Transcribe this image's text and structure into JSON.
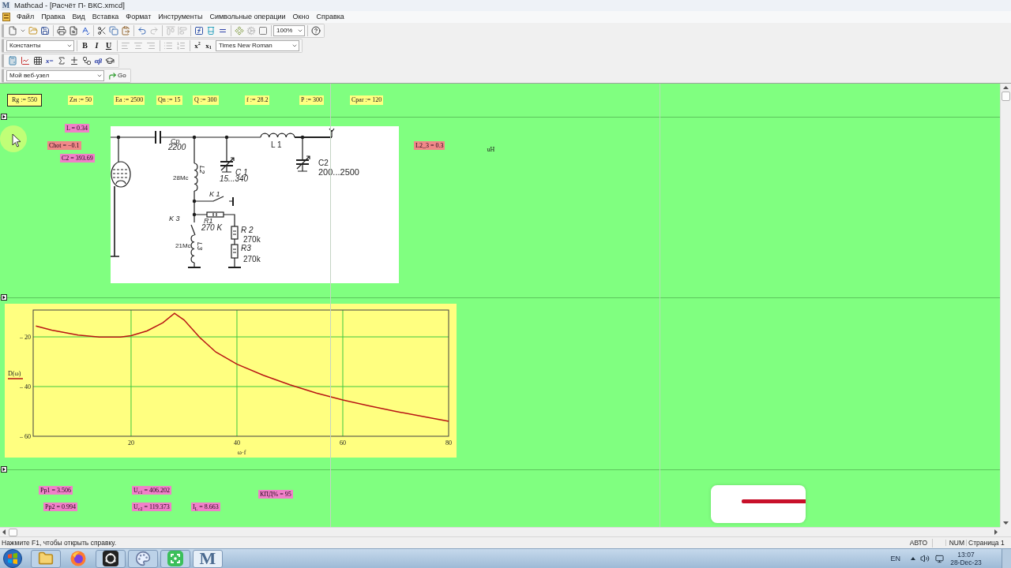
{
  "window": {
    "icon_letter": "M",
    "title": "Mathcad - [Расчёт П- ВКС.xmcd]"
  },
  "menu": [
    "Файл",
    "Правка",
    "Вид",
    "Вставка",
    "Формат",
    "Инструменты",
    "Символьные операции",
    "Окно",
    "Справка"
  ],
  "standard_toolbar": {
    "buttons": [
      {
        "disabled": false
      },
      {
        "disabled": false
      },
      {
        "disabled": false
      },
      {
        "disabled": false
      },
      {
        "disabled": false
      },
      {
        "disabled": false
      },
      {
        "disabled": false
      },
      {
        "disabled": false
      },
      {
        "disabled": false
      },
      {
        "disabled": false
      },
      {
        "disabled": false
      },
      {
        "disabled": true
      },
      {
        "disabled": true
      },
      {
        "disabled": true
      },
      {
        "disabled": false
      },
      {
        "disabled": false
      },
      {
        "disabled": false
      },
      {
        "disabled": false
      },
      {
        "disabled": true
      },
      {
        "disabled": false
      },
      {
        "disabled": false
      }
    ],
    "zoom": "100%"
  },
  "format_toolbar": {
    "style": "Константы",
    "text_buttons": [
      {
        "label": "B"
      },
      {
        "label": "I"
      },
      {
        "label": "U"
      }
    ],
    "align_buttons": [
      {
        "disabled": true
      },
      {
        "disabled": true
      },
      {
        "disabled": true
      }
    ],
    "list_buttons": [
      {
        "disabled": true
      },
      {
        "disabled": true
      }
    ],
    "script_buttons": [
      {
        "label": "x$^{2}$"
      },
      {
        "label": "x$_{1}$"
      }
    ],
    "font": "Times New Roman"
  },
  "math_toolbar": {
    "evaluation_label": "x=",
    "greek_label": "αβ"
  },
  "web_toolbar": {
    "address": "Мой веб-узел",
    "go": "Go"
  },
  "worksheet": {
    "definitions": [
      {
        "text": "Rg := 550",
        "selected": true
      },
      {
        "text": "Zн := 50",
        "selected": false
      },
      {
        "text": "Ea := 2500",
        "selected": false
      },
      {
        "text": "Qn := 15",
        "selected": false
      },
      {
        "text": "Q := 300",
        "selected": false
      },
      {
        "text": "f := 28.2",
        "selected": false
      },
      {
        "text": "P := 300",
        "selected": false
      },
      {
        "text": "Cpar := 120",
        "selected": false
      }
    ],
    "results_top": [
      {
        "text": "L = 0.34",
        "color": "#f080c8"
      },
      {
        "text": "Chot = −0.1",
        "color": "#f08888"
      },
      {
        "text": "C2 = 393.69",
        "color": "#f080c8"
      }
    ],
    "schematic": {
      "labels": [
        "Cp",
        "2200",
        "L 1",
        "C 1",
        "15...340",
        "C2",
        "200...2500",
        "28Mc",
        "L2",
        "K 1",
        "K 3",
        "R1",
        "270 K",
        "R 2",
        "270k",
        "R3",
        "270k",
        "21Mc",
        "L3"
      ]
    },
    "side_result": {
      "text": "L2_3 = 0.3",
      "color": "#f08888"
    },
    "unit_note": "uH",
    "plot": {
      "chart_data": {
        "type": "line",
        "xlabel": "ω·f",
        "ylabel": "D(ω)",
        "x": [
          2,
          5,
          10,
          14,
          18,
          20,
          23,
          26,
          28.2,
          30,
          33,
          36,
          40,
          45,
          50,
          55,
          60,
          65,
          70,
          75,
          80
        ],
        "series": [
          {
            "color": "#b81414",
            "values": [
              -15.6,
              -17.3,
              -19.3,
              -20.1,
              -20.1,
              -19.5,
              -17.6,
              -14.3,
              -10.5,
              -13.2,
              -20.3,
              -26.1,
              -31,
              -35.5,
              -39.3,
              -42.6,
              -45.4,
              -47.8,
              -50,
              -52,
              -54
            ]
          }
        ],
        "xlim": [
          1.5,
          80
        ],
        "ylim": [
          -60,
          -9.2
        ],
        "xticks": [
          20,
          40,
          60,
          80
        ],
        "yticks": [
          {
            "value": -20,
            "label": "– 20"
          },
          {
            "value": -40,
            "label": "– 40"
          },
          {
            "value": -60,
            "label": "– 60"
          }
        ],
        "grid": true
      }
    },
    "results_bottom": [
      {
        "text": "Pp1 = 3.506",
        "color": "#f080c8"
      },
      {
        "text": "Pp2 = 0.994",
        "color": "#f080c8"
      },
      {
        "text": "U$_{c1}$ = 406.202",
        "color": "#f080c8"
      },
      {
        "text": "U$_{c2}$ = 119.373",
        "color": "#f080c8"
      },
      {
        "text": "I$_{L}$ = 8.663",
        "color": "#f080c8"
      },
      {
        "text": "КПД% = 95",
        "color": "#f080c8"
      }
    ]
  },
  "status_bar": {
    "hint": "Нажмите F1, чтобы открыть справку.",
    "panels": [
      "АВТО",
      "NUM",
      "Страница 1"
    ]
  },
  "taskbar": {
    "apps": [
      {
        "running": true,
        "active": false
      },
      {
        "running": false,
        "active": false
      },
      {
        "running": true,
        "active": false
      },
      {
        "running": true,
        "active": false
      },
      {
        "running": true,
        "active": false
      },
      {
        "running": true,
        "active": true,
        "label": "M"
      }
    ],
    "language": "EN",
    "time": "13:07",
    "date": "28-Dec-23"
  }
}
